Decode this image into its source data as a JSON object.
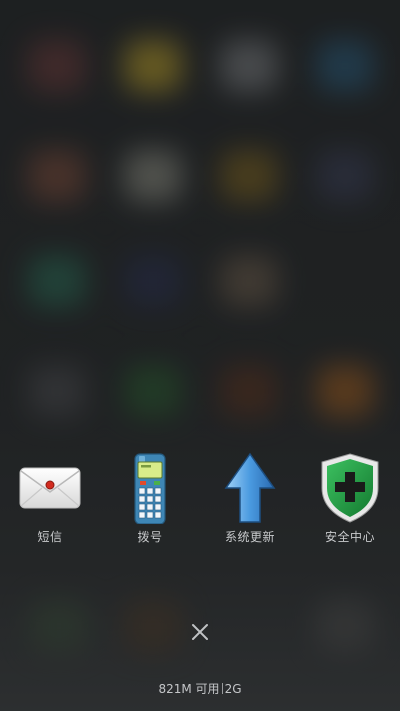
{
  "recent_apps": [
    {
      "label": "短信",
      "icon": "envelope-icon"
    },
    {
      "label": "拨号",
      "icon": "phone-dialer-icon"
    },
    {
      "label": "系统更新",
      "icon": "upload-arrow-icon"
    },
    {
      "label": "安全中心",
      "icon": "security-shield-icon"
    }
  ],
  "memory": {
    "available": "821M 可用",
    "total": "2G"
  },
  "colors": {
    "label_text": "#c9cbcd",
    "shield_green": "#1f9a3c",
    "arrow_blue": "#3d8fd6"
  }
}
